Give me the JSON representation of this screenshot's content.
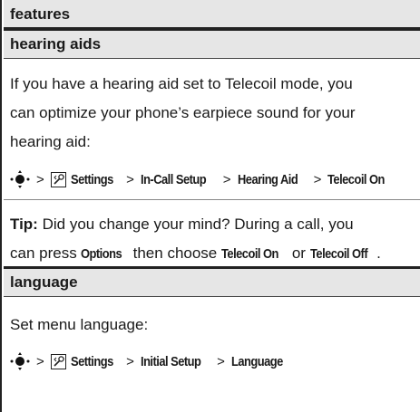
{
  "header": {
    "title": "features"
  },
  "hearing_aids": {
    "title": "hearing aids",
    "description_lines": [
      "If you have a hearing aid set to Telecoil mode, you",
      "can optimize your phone’s earpiece sound for your",
      "hearing aid:"
    ],
    "path": [
      "Settings",
      "In-Call Setup",
      "Hearing Aid",
      "Telecoil On"
    ],
    "tip": {
      "label": "Tip:",
      "line1_rest": " Did you change your mind? During a call, you",
      "line2_a": "can press ",
      "options_word": "Options",
      "line2_b": " then choose ",
      "telecoil_on": "Telecoil On",
      "line2_c": " or ",
      "telecoil_off": "Telecoil Off",
      "line2_d": "."
    }
  },
  "language": {
    "title": "language",
    "description": "Set menu language:",
    "path": [
      "Settings",
      "Initial Setup",
      "Language"
    ]
  },
  "separator": ">",
  "icons": {
    "nav": "nav-key-icon",
    "settings": "settings-menu-icon"
  }
}
